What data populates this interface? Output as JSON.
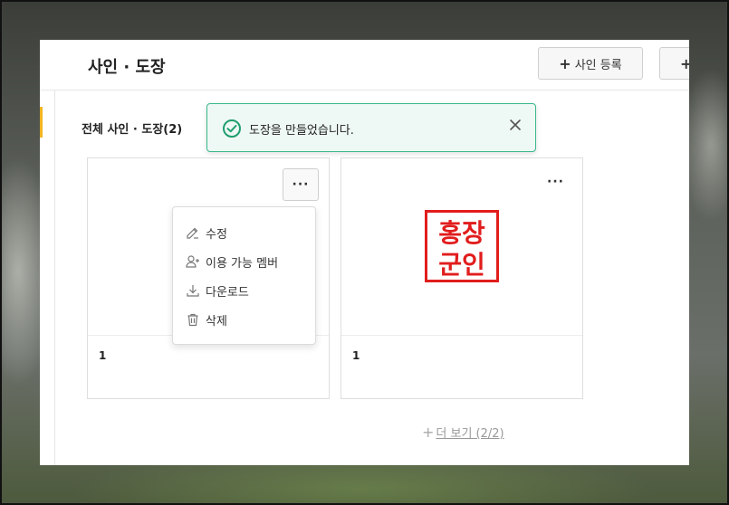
{
  "header": {
    "title": "사인 · 도장",
    "register_button": "사인 등록",
    "second_button": ""
  },
  "section": {
    "title": "전체 사인 · 도장(2)"
  },
  "toast": {
    "message": "도장을 만들었습니다."
  },
  "cards": [
    {
      "name": "1",
      "more_label": "···"
    },
    {
      "name": "1",
      "more_label": "···",
      "stamp_text": [
        "홍장",
        "군인"
      ]
    }
  ],
  "context_menu": {
    "items": [
      {
        "label": "수정",
        "icon": "edit-icon"
      },
      {
        "label": "이용 가능 멤버",
        "icon": "add-user-icon"
      },
      {
        "label": "다운로드",
        "icon": "download-icon"
      },
      {
        "label": "삭제",
        "icon": "trash-icon"
      }
    ]
  },
  "pagination": {
    "more_label": "더 보기 (2/2)"
  },
  "colors": {
    "accent": "#f2b420",
    "toast_border": "#39b98a",
    "toast_bg": "#eef8f4",
    "stamp_red": "#e11d1d"
  }
}
